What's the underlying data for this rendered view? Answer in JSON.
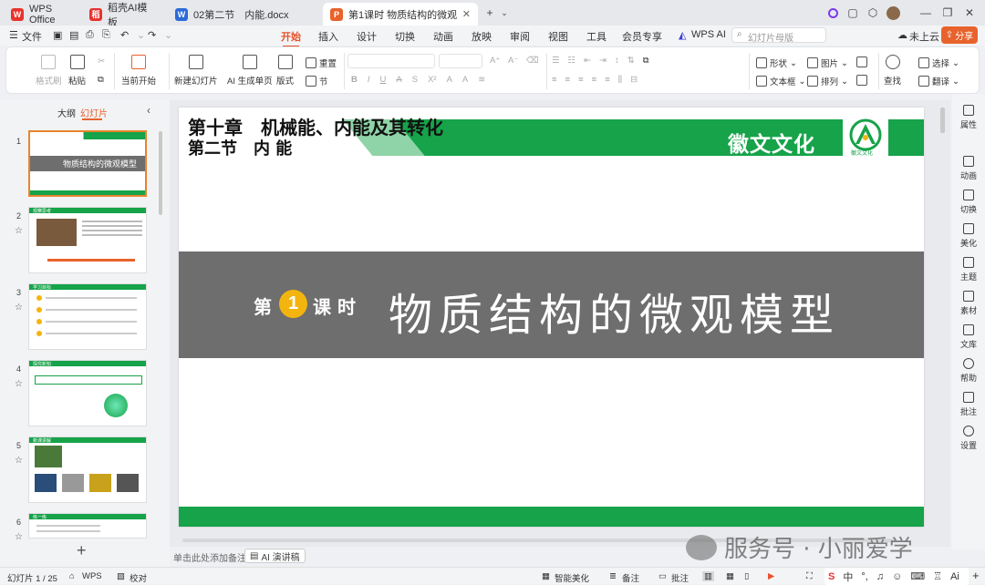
{
  "tabs": [
    {
      "label": "WPS Office",
      "icon": "wps-logo-icon",
      "color": "#e8322d"
    },
    {
      "label": "稻壳AI模板",
      "icon": "docer-icon",
      "color": "#e8322d"
    },
    {
      "label": "02第二节　内能.docx",
      "icon": "word-doc-icon",
      "color": "#2b6bd8"
    },
    {
      "label": "第1课时  物质结构的微观模型",
      "icon": "ppt-doc-icon",
      "color": "#e8622d"
    }
  ],
  "menu": {
    "file": "文件",
    "items": [
      "开始",
      "插入",
      "设计",
      "切换",
      "动画",
      "放映",
      "审阅",
      "视图",
      "工具",
      "会员专享"
    ],
    "active": "开始",
    "wps_ai": "WPS AI",
    "search_placeholder": "幻灯片母版",
    "cloud": "未上云",
    "share": "分享"
  },
  "ribbon": {
    "format_painter": "格式刷",
    "paste": "粘贴",
    "from_current": "当前开始",
    "new_slide": "新建幻灯片",
    "ai_slide": "AI 生成单页",
    "layout": "版式",
    "reset": "重置",
    "section": "节",
    "shape": "形状",
    "image": "图片",
    "textbox": "文本框",
    "arrange": "排列",
    "find": "查找",
    "select": "选择",
    "translate": "翻译"
  },
  "panel": {
    "outline": "大纲",
    "slides": "幻灯片"
  },
  "slides": [
    {
      "num": "1",
      "title": "物质结构的微观模型"
    },
    {
      "num": "2",
      "title": "观察思考"
    },
    {
      "num": "3",
      "title": "学习目标"
    },
    {
      "num": "4",
      "title": "探究新知"
    },
    {
      "num": "5",
      "title": "新课讲解"
    },
    {
      "num": "6",
      "title": "练一练"
    }
  ],
  "slide": {
    "chapter": "第十章　机械能、内能及其转化",
    "section": "第二节　内 能",
    "brand": "徽文文化",
    "logo_text": "徽文文化",
    "lesson_pre": "第",
    "lesson_num": "1",
    "lesson_post": "课 时",
    "title": "物质结构的微观模型",
    "green": "#16a34a",
    "gray": "#6e6e6e",
    "yellow": "#f3b40f"
  },
  "notes_placeholder": "单击此处添加备注",
  "ai_speech": "AI 演讲稿",
  "right_bar": [
    "属性",
    "动画",
    "切换",
    "美化",
    "主题",
    "素材",
    "文库",
    "帮助",
    "批注",
    "设置"
  ],
  "status": {
    "slide_count": "幻灯片 1 / 25",
    "wps": "WPS",
    "proof": "校对",
    "beautify": "智能美化",
    "notes": "备注",
    "comments": "批注",
    "ime": "中",
    "watermark": "服务号 · 小丽爱学"
  }
}
